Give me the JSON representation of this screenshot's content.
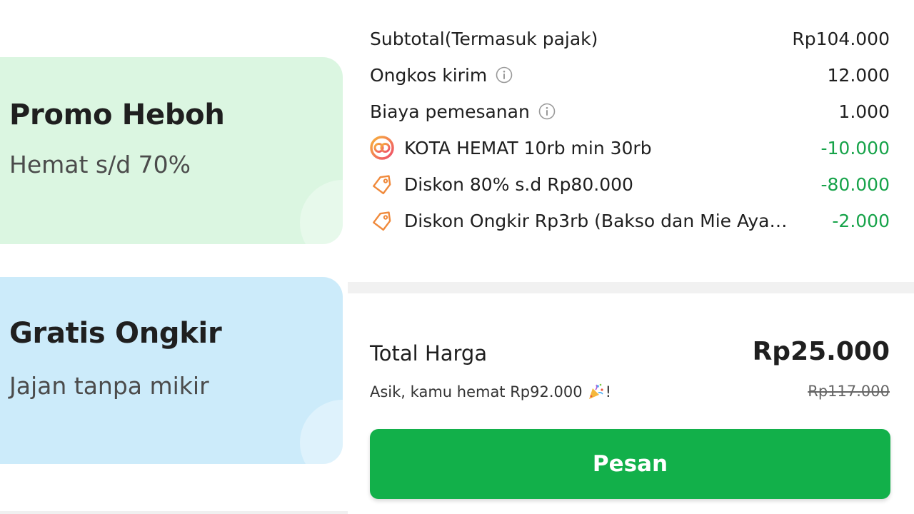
{
  "promos": {
    "heboh": {
      "title": "Promo Heboh",
      "subtitle": "Hemat s/d 70%",
      "color": "#dbf6e1"
    },
    "ongkir": {
      "title": "Gratis Ongkir",
      "subtitle": "Jajan tanpa mikir",
      "color": "#ccebfa"
    }
  },
  "summary": {
    "subtotal": {
      "label": "Subtotal(Termasuk pajak)",
      "value": "Rp104.000"
    },
    "delivery": {
      "label": "Ongkos kirim",
      "value": "12.000",
      "icon": "info-icon"
    },
    "order_fee": {
      "label": "Biaya pemesanan",
      "value": "1.000",
      "icon": "info-icon"
    },
    "discounts": [
      {
        "label": "KOTA HEMAT 10rb min 30rb",
        "value": "-10.000",
        "icon": "kota-hemat-icon"
      },
      {
        "label": "Diskon 80% s.d Rp80.000",
        "value": "-80.000",
        "icon": "tag-icon"
      },
      {
        "label": "Diskon Ongkir Rp3rb (Bakso dan Mie Ayam...",
        "value": "-2.000",
        "icon": "tag-icon"
      }
    ]
  },
  "total": {
    "label": "Total Harga",
    "value": "Rp25.000",
    "savings_text": "Asik, kamu hemat Rp92.000",
    "savings_suffix": "!",
    "original_price": "Rp117.000"
  },
  "order_button": {
    "label": "Pesan"
  },
  "colors": {
    "accent_green": "#12b04a",
    "discount_green": "#17a34a",
    "tag_orange": "#f08a3c"
  }
}
